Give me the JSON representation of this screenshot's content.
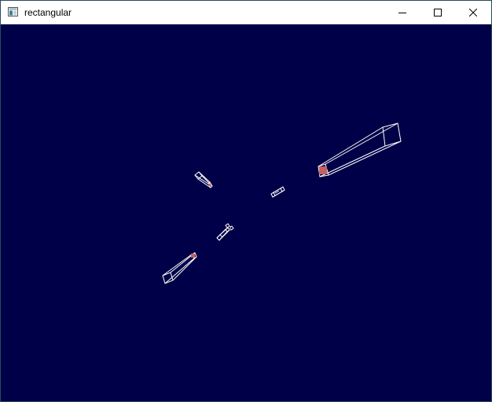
{
  "window": {
    "title": "rectangular",
    "app_icon": "window-app-icon",
    "controls": {
      "minimize_icon": "minimize-icon",
      "maximize_icon": "maximize-icon",
      "close_icon": "close-icon"
    }
  },
  "scene": {
    "background_color": "#000048",
    "wireframe_color": "#ffffff",
    "cap_color": "#c86060",
    "object_count": 6
  }
}
